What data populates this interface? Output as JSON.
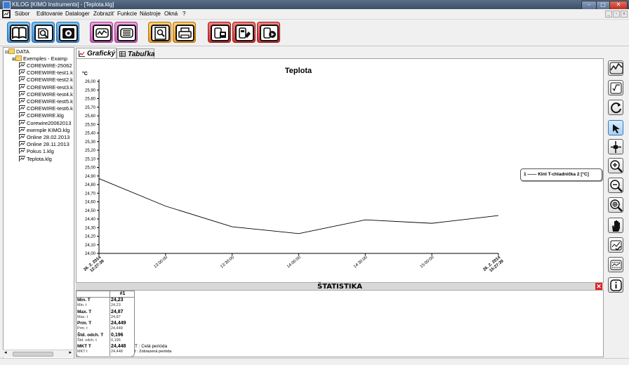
{
  "window": {
    "title": "KILOG [KIMO Instruments] - [Teplota.klg]"
  },
  "menu": [
    "Súbor",
    "Editovanie",
    "Dataloger",
    "Zobraziť",
    "Funkcie",
    "Nástroje",
    "Okná",
    "?"
  ],
  "tree": {
    "root": "DATA",
    "folder": "Exemples - Examp",
    "files": [
      "COREWIRE-25062",
      "COREWIRE-test1.k",
      "COREWIRE-test2.k",
      "COREWIRE-test3.k",
      "COREWIRE-test4.k",
      "COREWIRE-test5.k",
      "COREWIRE-test6.k",
      "COREWIRE.klg",
      "Corewire20062013",
      "exemple KIMO.klg",
      "Online 28.02.2013",
      "Online 28.11.2013",
      "Pokus 1.klg",
      "Teplota.klg"
    ]
  },
  "tabs": {
    "graph": "Grafický",
    "table": "Tabuľka"
  },
  "chart_data": {
    "type": "line",
    "title": "Teplota",
    "ylabel": "°C",
    "ylim": [
      24.0,
      26.0
    ],
    "yticks": [
      "24,00",
      "24,10",
      "24,20",
      "24,30",
      "24,40",
      "24,50",
      "24,60",
      "24,70",
      "24,80",
      "24,90",
      "25,00",
      "25,10",
      "25,20",
      "25,30",
      "25,40",
      "25,50",
      "25,60",
      "25,70",
      "25,80",
      "25,90",
      "26,00"
    ],
    "xticks": [
      {
        "t": 0,
        "lines": [
          "26. 2. 2014",
          "12:27:39"
        ],
        "bold": true
      },
      {
        "t": 0.2,
        "lines": [
          "13:00:00"
        ],
        "bold": false
      },
      {
        "t": 0.4,
        "lines": [
          "13:30:00"
        ],
        "bold": false
      },
      {
        "t": 0.6,
        "lines": [
          "14:00:00"
        ],
        "bold": false
      },
      {
        "t": 0.8,
        "lines": [
          "14:30:00"
        ],
        "bold": false
      },
      {
        "t": 1.0,
        "lines": [
          "15:00:00"
        ],
        "bold": false
      },
      {
        "t": 1.2,
        "lines": [
          "26. 2. 2014",
          "15:27:39"
        ],
        "bold": true
      }
    ],
    "series": [
      {
        "name": "1 —— Klnt T-chladnička 2 [°C]",
        "color": "#000000",
        "x": [
          "12:27:39",
          "13:00:00",
          "13:30:00",
          "14:00:00",
          "14:30:00",
          "15:00:00",
          "15:27:39"
        ],
        "values": [
          24.87,
          24.55,
          24.31,
          24.23,
          24.39,
          24.35,
          24.44
        ]
      }
    ],
    "grid": false,
    "legend_position": "right"
  },
  "stats": {
    "title": "ŠTATISTIKA",
    "col_header": "#1",
    "rows": [
      {
        "label": "Min. T",
        "sub": "Min. t",
        "value": "24,23",
        "subvalue": "24,23"
      },
      {
        "label": "Max. T",
        "sub": "Max. t",
        "value": "24,87",
        "subvalue": "24,87"
      },
      {
        "label": "Prm. T",
        "sub": "Prm. t",
        "value": "24,449",
        "subvalue": "24,449"
      },
      {
        "label": "Štd. odch. T",
        "sub": "Štd. odch. t",
        "value": "0,196",
        "subvalue": "0,196"
      },
      {
        "label": "MKT T",
        "sub": "MKT t",
        "value": "24,448",
        "subvalue": "24,448"
      }
    ],
    "note1": "T : Celá perióda",
    "note2": "t : Zobrazená perióda"
  },
  "toolbar_icons": [
    "book-icon",
    "search-doc-icon",
    "camera-icon",
    "chart-export-icon",
    "print-list-icon",
    "zoom-report-icon",
    "printer-icon",
    "logger-read-icon",
    "logger-config-icon",
    "logger-start-icon"
  ],
  "right_tools": [
    "curve-icon",
    "sqrt-icon",
    "refresh-icon",
    "pointer-icon",
    "crosshair-icon",
    "zoom-in-icon",
    "zoom-out-icon",
    "zoom-fit-icon",
    "hand-icon",
    "check-chart-icon",
    "alarm-chart-icon",
    "info-icon"
  ],
  "colors": {
    "accent_orange": "#f5a623",
    "accent_pink": "#d86fc8",
    "accent_red": "#e03030",
    "accent_blue": "#4aa3e8"
  }
}
